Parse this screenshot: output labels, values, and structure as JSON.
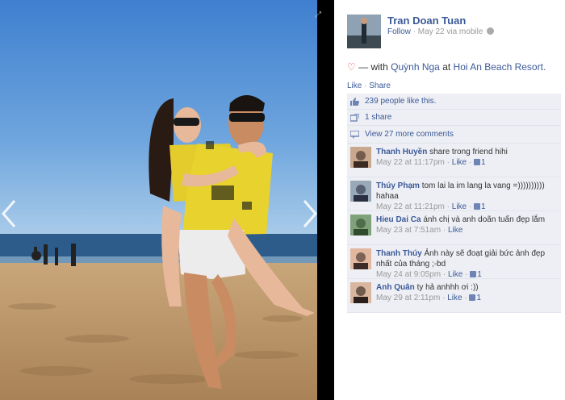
{
  "photo": {
    "prev_arrow": "chevron-left-icon",
    "next_arrow": "chevron-right-icon"
  },
  "post": {
    "author": "Tran Doan Tuan",
    "follow": "Follow",
    "date": "May 22 via mobile",
    "status_dash": "— with",
    "tagged": "Quỳnh Nga",
    "at": "at",
    "place": "Hoi An Beach Resort.",
    "like_label": "Like",
    "share_label": "Share",
    "likes_text": "239 people like this.",
    "shares_text": "1 share",
    "more_comments": "View 27 more comments"
  },
  "comments": [
    {
      "name": "Thanh Huyền",
      "text": "share trong friend hihi",
      "time": "May 22 at 11:17pm",
      "like": "Like",
      "count": "1"
    },
    {
      "name": "Thúy Phạm",
      "text": "tom lai la im lang la vang =)))))))))) hahaa",
      "time": "May 22 at 11:21pm",
      "like": "Like",
      "count": "1"
    },
    {
      "name": "Hieu Dai Ca",
      "text": "ánh chị và anh doãn tuấn đẹp lắm",
      "time": "May 23 at 7:51am",
      "like": "Like",
      "count": ""
    },
    {
      "name": "Thanh Thúy",
      "text": "Ảnh này sẽ đoạt giải bức ảnh đẹp nhất của tháng ;-bd",
      "time": "May 24 at 9:05pm",
      "like": "Like",
      "count": "1"
    },
    {
      "name": "Anh Quân",
      "text": "ty hả anhhh ơi :))",
      "time": "May 29 at 2:11pm",
      "like": "Like",
      "count": "1"
    }
  ],
  "colors": {
    "link": "#3b5998",
    "panel": "#edeff4",
    "heart": "#e04a4a"
  }
}
